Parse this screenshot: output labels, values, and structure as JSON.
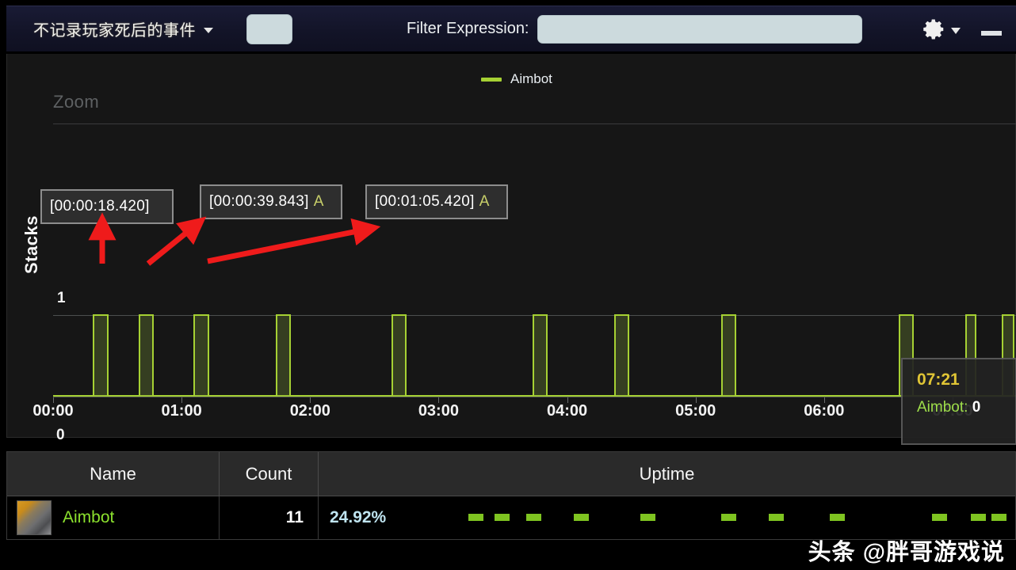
{
  "toolbar": {
    "dropdown_label": "不记录玩家死后的事件",
    "dropdown_caret_icon": "chevron-down-icon",
    "blank_button_label": "",
    "filter_label": "Filter Expression:",
    "filter_value": "",
    "filter_placeholder": "",
    "gear_icon": "gear-icon",
    "gear_caret_icon": "chevron-down-icon",
    "minimize_icon": "minimize-icon"
  },
  "chart_panel": {
    "zoom_label": "Zoom",
    "legend": [
      {
        "label": "Aimbot",
        "color": "#a6d133"
      }
    ],
    "tooltip": {
      "time": "07:21",
      "series_label": "Aimbot:",
      "value": "0"
    },
    "callouts": [
      {
        "text": "[00:00:18.420]",
        "suffix": ""
      },
      {
        "text": "[00:00:39.843]",
        "suffix": "A"
      },
      {
        "text": "[00:01:05.420]",
        "suffix": "A"
      }
    ]
  },
  "chart_data": {
    "type": "area",
    "title": "",
    "subtitle": "",
    "xlabel": "",
    "ylabel": "Stacks",
    "ylim": [
      0,
      1
    ],
    "yticks": [
      "0",
      "1"
    ],
    "xlim": [
      "00:00",
      "07:30"
    ],
    "xticks": [
      "00:00",
      "01:00",
      "02:00",
      "03:00",
      "04:00",
      "05:00",
      "06:00",
      "07:00"
    ],
    "grid": true,
    "legend_position": "top-center",
    "series": [
      {
        "name": "Aimbot",
        "color": "#a6d133",
        "fill": "rgba(120,150,60,0.32)",
        "step": true,
        "pulses": [
          {
            "start": "00:00:18.4",
            "end": "00:00:26.0",
            "value": 1
          },
          {
            "start": "00:00:39.8",
            "end": "00:00:47.0",
            "value": 1
          },
          {
            "start": "00:01:05.4",
            "end": "00:01:13.0",
            "value": 1
          },
          {
            "start": "00:01:44.0",
            "end": "00:01:51.0",
            "value": 1
          },
          {
            "start": "00:02:38.0",
            "end": "00:02:45.0",
            "value": 1
          },
          {
            "start": "00:03:44.0",
            "end": "00:03:51.0",
            "value": 1
          },
          {
            "start": "00:04:22.0",
            "end": "00:04:29.0",
            "value": 1
          },
          {
            "start": "00:05:12.0",
            "end": "00:05:19.0",
            "value": 1
          },
          {
            "start": "00:06:35.0",
            "end": "00:06:42.0",
            "value": 1
          },
          {
            "start": "00:07:06.0",
            "end": "00:07:11.0",
            "value": 1
          },
          {
            "start": "00:07:23.0",
            "end": "00:07:29.0",
            "value": 1
          }
        ]
      }
    ]
  },
  "table": {
    "columns": [
      "Name",
      "Count",
      "Uptime"
    ],
    "rows": [
      {
        "icon": "aimbot-thumbnail",
        "name": "Aimbot",
        "count": "11",
        "uptime_pct": "24.92%",
        "uptime_segments": 11
      }
    ]
  },
  "watermark": {
    "text": "头条 @胖哥游戏说"
  }
}
